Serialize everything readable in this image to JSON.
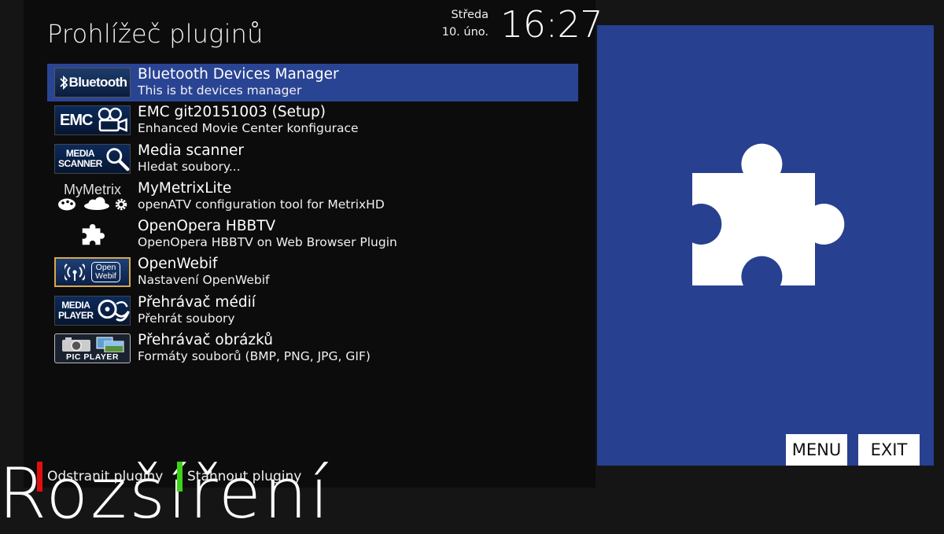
{
  "header": {
    "title": "Prohlížeč pluginů",
    "day": "Středa",
    "date": "10. úno.",
    "time": "16:27"
  },
  "plugins": [
    {
      "name": "Bluetooth Devices Manager",
      "description": "This is bt devices manager",
      "icon": "bluetooth-logo",
      "logo_text": "Bluetooth",
      "selected": true
    },
    {
      "name": "EMC git20151003 (Setup)",
      "description": "Enhanced Movie Center konfigurace",
      "icon": "emc-logo",
      "logo_text": "EMC"
    },
    {
      "name": "Media scanner",
      "description": "Hledat soubory...",
      "icon": "media-scanner-logo",
      "logo_text_1": "MEDIA",
      "logo_text_2": "SCANNER"
    },
    {
      "name": "MyMetrixLite",
      "description": "openATV configuration tool for MetrixHD",
      "icon": "mymetrix-logo",
      "logo_text": "MyMetrix"
    },
    {
      "name": "OpenOpera HBBTV",
      "description": "OpenOpera HBBTV on Web Browser Plugin",
      "icon": "puzzle-icon"
    },
    {
      "name": "OpenWebif",
      "description": "Nastavení OpenWebif",
      "icon": "openwebif-logo",
      "logo_text_1": "Open",
      "logo_text_2": "Webif"
    },
    {
      "name": "Přehrávač médií",
      "description": "Přehrát soubory",
      "icon": "media-player-logo",
      "logo_text_1": "MEDIA",
      "logo_text_2": "PLAYER"
    },
    {
      "name": "Přehrávač obrázků",
      "description": "Formáty souborů (BMP, PNG, JPG, GIF)",
      "icon": "pic-player-logo",
      "logo_text": "PIC PLAYER"
    }
  ],
  "preview": {
    "icon": "puzzle-icon"
  },
  "buttons": {
    "menu": "MENU",
    "exit": "EXIT"
  },
  "footer": {
    "big_label": "Rozšíření",
    "red_key": "Odstranit pluginy",
    "green_key": "Stáhnout pluginy"
  },
  "colors": {
    "selection": "#2a4494",
    "preview_bg": "#27408f",
    "red_key": "#e01010",
    "green_key": "#3fd21a"
  }
}
